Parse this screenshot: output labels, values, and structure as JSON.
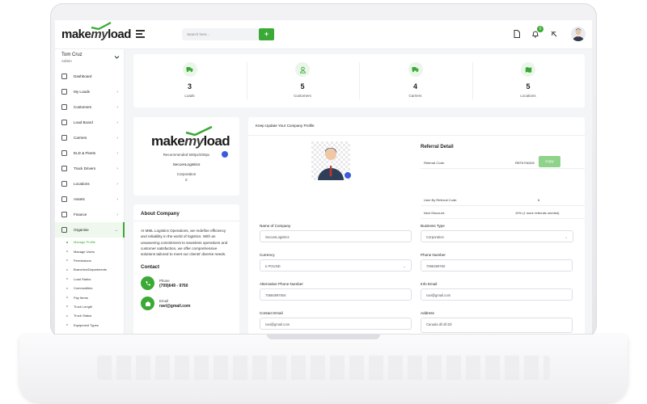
{
  "brand": {
    "make": "make",
    "my": "my",
    "load": "load",
    "accent": "#3aa935"
  },
  "topbar": {
    "search_placeholder": "Search here...",
    "add_label": "+",
    "notification_count": "0"
  },
  "user": {
    "name": "Tom Cruz",
    "role": "Admin"
  },
  "sidebar": {
    "items": [
      {
        "label": "Dashboard",
        "icon": "dashboard-icon",
        "arrow": ""
      },
      {
        "label": "My Loads",
        "icon": "loads-icon",
        "arrow": "›"
      },
      {
        "label": "Customers",
        "icon": "customers-icon",
        "arrow": "›"
      },
      {
        "label": "Load Board",
        "icon": "load-board-icon",
        "arrow": "›"
      },
      {
        "label": "Carriers",
        "icon": "carriers-icon",
        "arrow": "›"
      },
      {
        "label": "ELD & Fleets",
        "icon": "fleet-icon",
        "arrow": "›"
      },
      {
        "label": "Track Drivers",
        "icon": "track-icon",
        "arrow": "›"
      },
      {
        "label": "Locations",
        "icon": "location-icon",
        "arrow": "›"
      },
      {
        "label": "Assets",
        "icon": "assets-icon",
        "arrow": "›"
      },
      {
        "label": "Finance",
        "icon": "finance-icon",
        "arrow": "›"
      },
      {
        "label": "Organise",
        "icon": "organise-icon",
        "arrow": "⌄"
      }
    ],
    "subitems": [
      "Manage Profile",
      "Manage Users",
      "Permissions",
      "Branches/Departments",
      "Load Status",
      "Commodities",
      "Pay Items",
      "Truck Length",
      "Truck Status",
      "Equipment Types"
    ]
  },
  "stats": [
    {
      "value": "3",
      "label": "Loads",
      "icon": "truck-icon"
    },
    {
      "value": "5",
      "label": "Customers",
      "icon": "user-icon"
    },
    {
      "value": "4",
      "label": "Carriers",
      "icon": "truck-icon"
    },
    {
      "value": "5",
      "label": "Locations",
      "icon": "map-icon"
    }
  ],
  "company_card": {
    "recommended": "Recommended 500px/200px",
    "name": "SecureLogistics",
    "type": "Corporation",
    "currency_symbol": "£"
  },
  "about": {
    "title": "About Company",
    "text": "At MML Logistics Operations, we redefine efficiency and reliability in the world of logistics. With an unwavering commitment to seamless operations and customer satisfaction, we offer comprehensive solutions tailored to meet our clients' diverse needs.",
    "contact_title": "Contact",
    "phone_label": "Phone",
    "phone_value": "(709)649 - 9760",
    "email_label": "Email",
    "email_value": "ravi@gmail.com"
  },
  "profile": {
    "title": "Keep Update Your Company Profile",
    "referral": {
      "title": "Referral Detail",
      "rows": [
        {
          "label": "Referral Code:",
          "value": "REF6706328"
        },
        {
          "label": "User By Referral Code:",
          "value": "6"
        },
        {
          "label": "Next Discount:",
          "value": "10% (1 more referrals needed)"
        }
      ],
      "copy_label": "Copy"
    },
    "fields": {
      "company_name": {
        "label": "Name of Company",
        "value": "SecureLogistics"
      },
      "business_type": {
        "label": "Business Type",
        "value": "Corporation"
      },
      "currency": {
        "label": "Currency",
        "value": "£ POUND"
      },
      "phone": {
        "label": "Phone Number",
        "value": "7068499760"
      },
      "alt_phone": {
        "label": "Alternative Phone Number",
        "value": "70684997604"
      },
      "info_email": {
        "label": "Info Email",
        "value": "ravi@gmail.com"
      },
      "contact_email": {
        "label": "Contact Email",
        "value": "ravi@gmail.com"
      },
      "address": {
        "label": "Address",
        "value": "Canada dil dil Dil"
      }
    }
  }
}
